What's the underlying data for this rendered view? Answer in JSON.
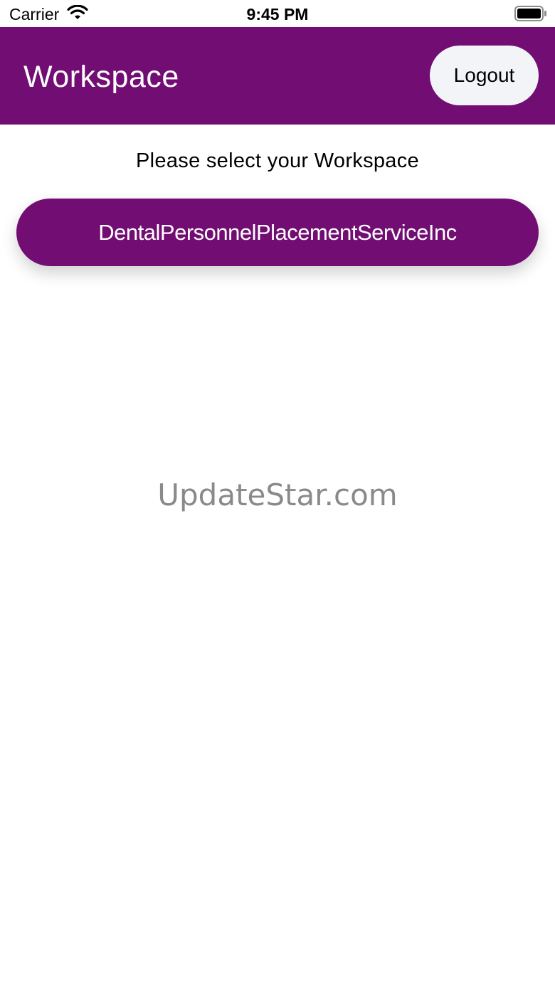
{
  "status_bar": {
    "carrier": "Carrier",
    "time": "9:45 PM",
    "wifi_icon": "wifi-icon",
    "battery_icon": "battery-icon"
  },
  "header": {
    "title": "Workspace",
    "logout_label": "Logout",
    "background_color": "#720e73"
  },
  "main": {
    "prompt": "Please select your Workspace",
    "workspaces": [
      {
        "label": "DentalPersonnelPlacementServiceInc"
      }
    ]
  },
  "watermark": "UpdateStar.com"
}
